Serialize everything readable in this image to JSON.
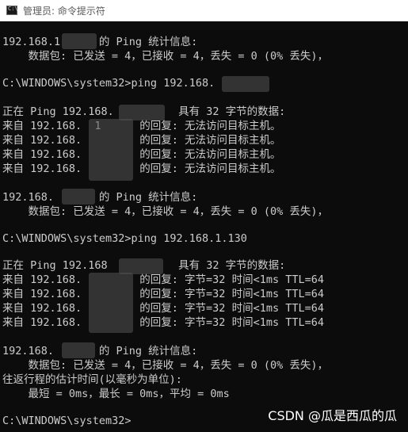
{
  "window": {
    "title": "管理员: 命令提示符",
    "icon": "cmd-icon"
  },
  "console": {
    "lines": [
      "192.168.1      的 Ping 统计信息:",
      "    数据包: 已发送 = 4，已接收 = 4，丢失 = 0 (0% 丢失)，",
      "",
      "C:\\WINDOWS\\system32>ping 192.168.",
      "",
      "正在 Ping 192.168.          具有 32 字节的数据:",
      "来自 192.168.  1      的回复: 无法访问目标主机。",
      "来自 192.168.         的回复: 无法访问目标主机。",
      "来自 192.168.         的回复: 无法访问目标主机。",
      "来自 192.168.         的回复: 无法访问目标主机。",
      "",
      "192.168.       的 Ping 统计信息:",
      "    数据包: 已发送 = 4，已接收 = 4，丢失 = 0 (0% 丢失)，",
      "",
      "C:\\WINDOWS\\system32>ping 192.168.1.130",
      "",
      "正在 Ping 192.168           具有 32 字节的数据:",
      "来自 192.168.         的回复: 字节=32 时间<1ms TTL=64",
      "来自 192.168.         的回复: 字节=32 时间<1ms TTL=64",
      "来自 192.168.         的回复: 字节=32 时间<1ms TTL=64",
      "来自 192.168.         的回复: 字节=32 时间<1ms TTL=64",
      "",
      "192.168.       的 Ping 统计信息:",
      "    数据包: 已发送 = 4，已接收 = 4，丢失 = 0 (0% 丢失)，",
      "往返行程的估计时间(以毫秒为单位):",
      "    最短 = 0ms，最长 = 0ms，平均 = 0ms",
      "",
      "C:\\WINDOWS\\system32>"
    ]
  },
  "watermark": "CSDN @瓜是西瓜的瓜"
}
